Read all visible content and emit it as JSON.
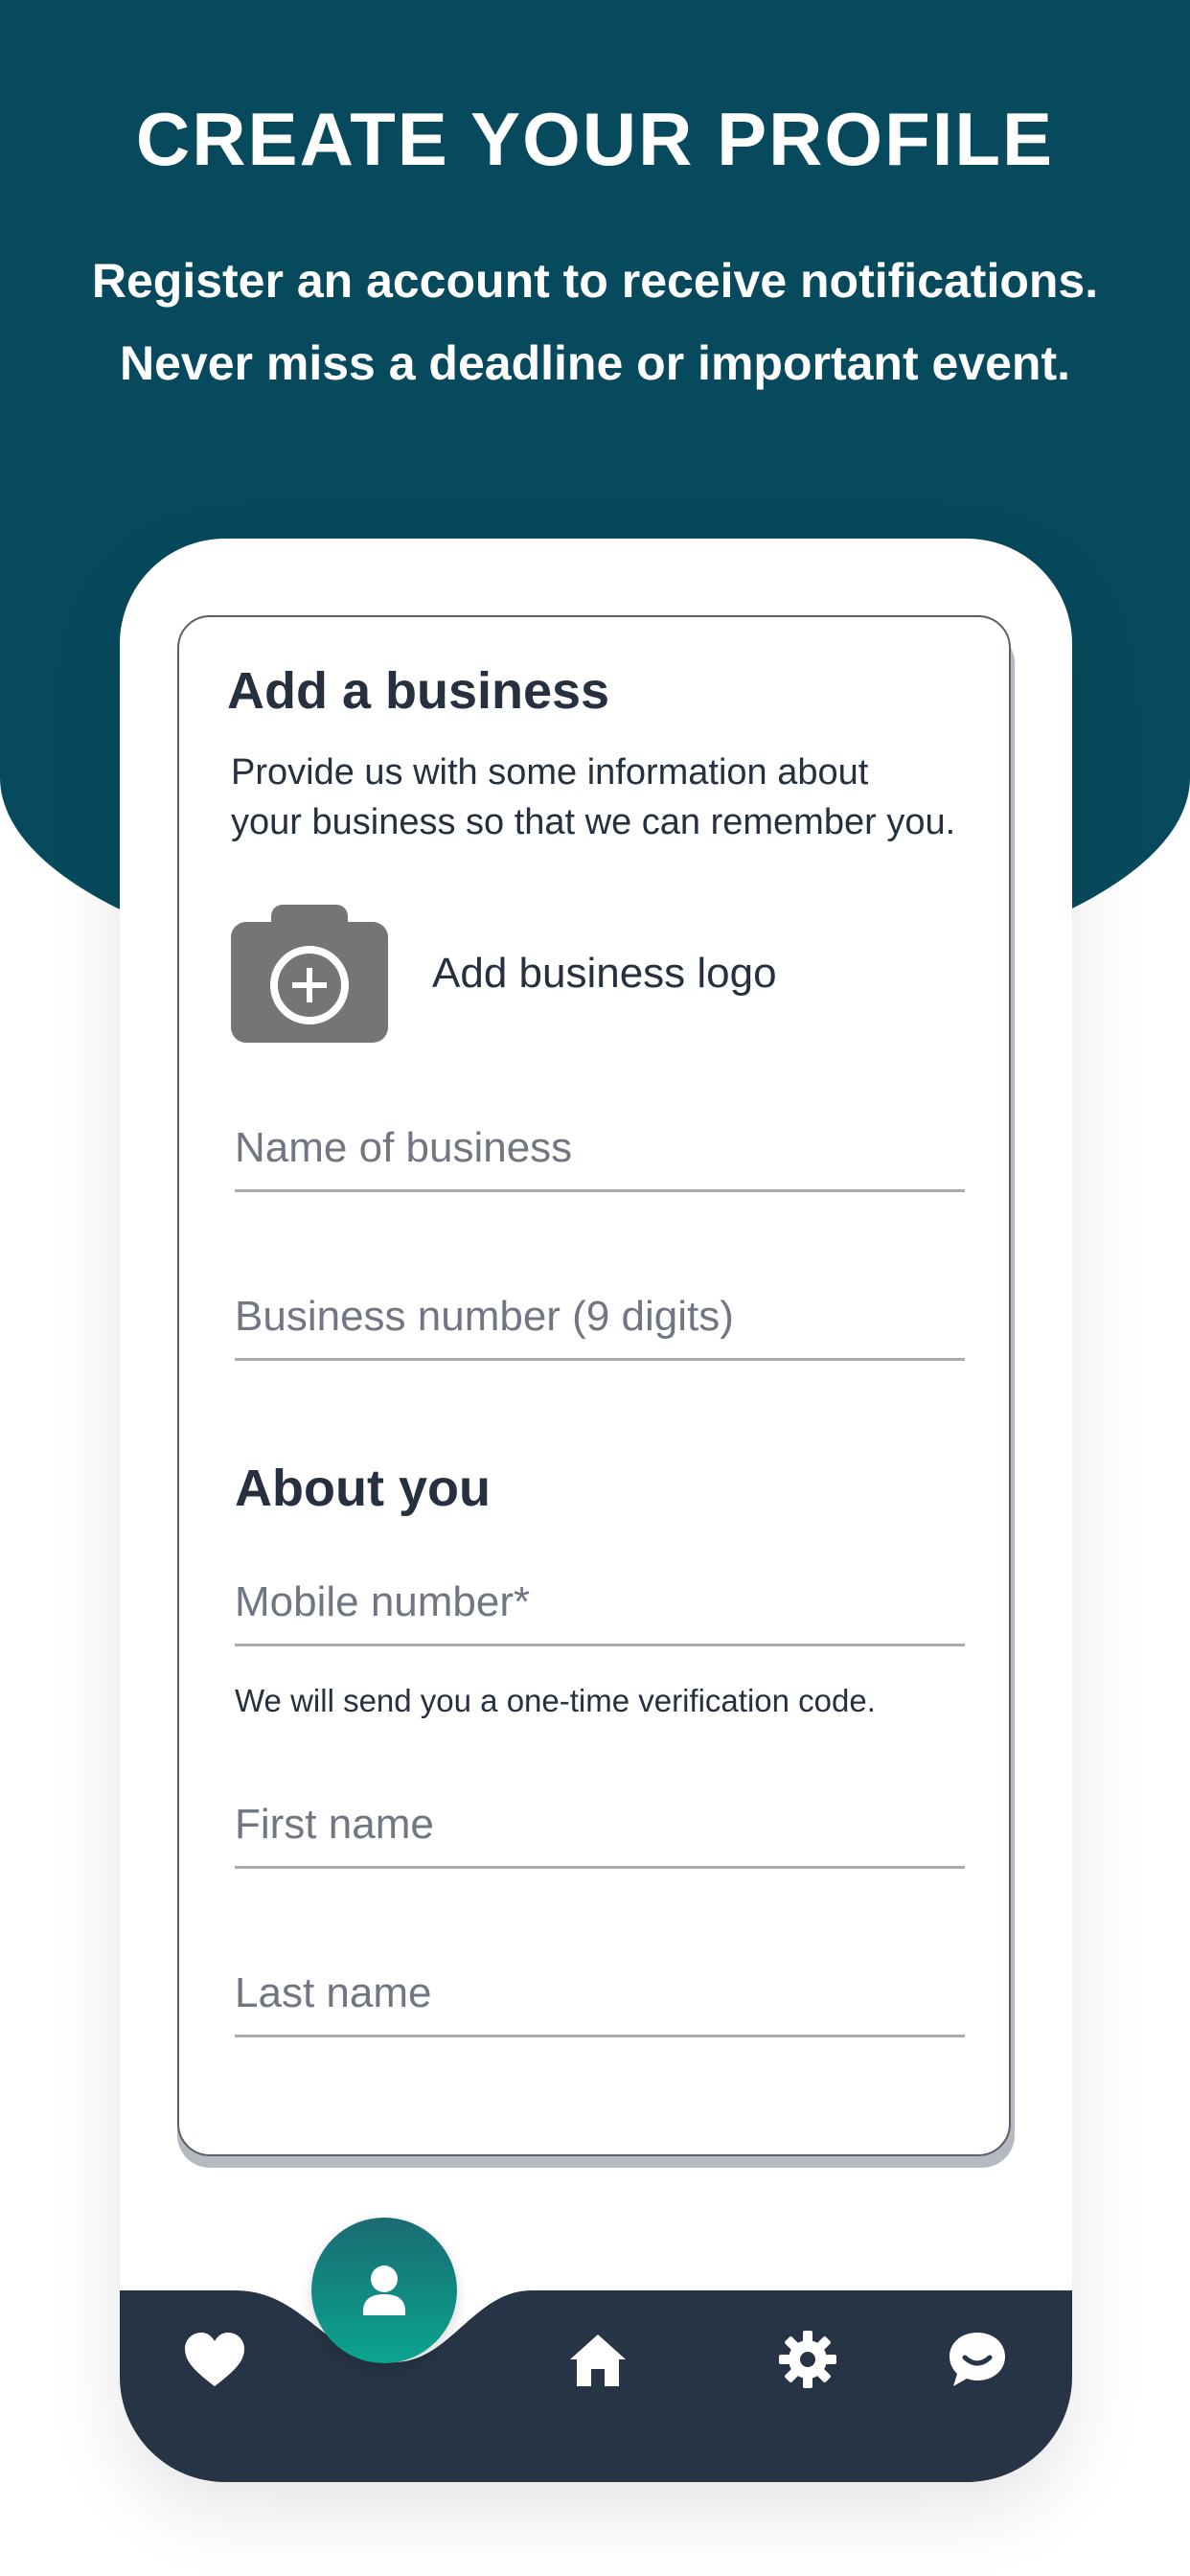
{
  "hero": {
    "title": "CREATE YOUR PROFILE",
    "subtitle_line1": "Register an account to receive notifications.",
    "subtitle_line2": "Never miss a deadline or important event."
  },
  "business": {
    "title": "Add a business",
    "desc_line1": "Provide us with some information about",
    "desc_line2": "your business so that we can remember you.",
    "logo_label": "Add business logo",
    "name_placeholder": "Name of business",
    "name_value": "",
    "number_placeholder": "Business number (9 digits)",
    "number_value": ""
  },
  "about": {
    "title": "About you",
    "mobile_placeholder": "Mobile number*",
    "mobile_value": "",
    "mobile_helper": "We will send you a one-time verification code.",
    "first_placeholder": "First name",
    "first_value": "",
    "last_placeholder": "Last name",
    "last_value": ""
  },
  "nav": {
    "items": [
      {
        "icon": "heart-icon"
      },
      {
        "icon": "user-icon",
        "active": true
      },
      {
        "icon": "home-icon"
      },
      {
        "icon": "gear-icon"
      },
      {
        "icon": "chat-icon"
      }
    ]
  },
  "colors": {
    "hero_bg": "#074a5d",
    "text_dark": "#26303f",
    "nav_bg": "#263445",
    "fab_top": "#1a6b73",
    "fab_bottom": "#0aa58e",
    "camera_gray": "#757575"
  }
}
